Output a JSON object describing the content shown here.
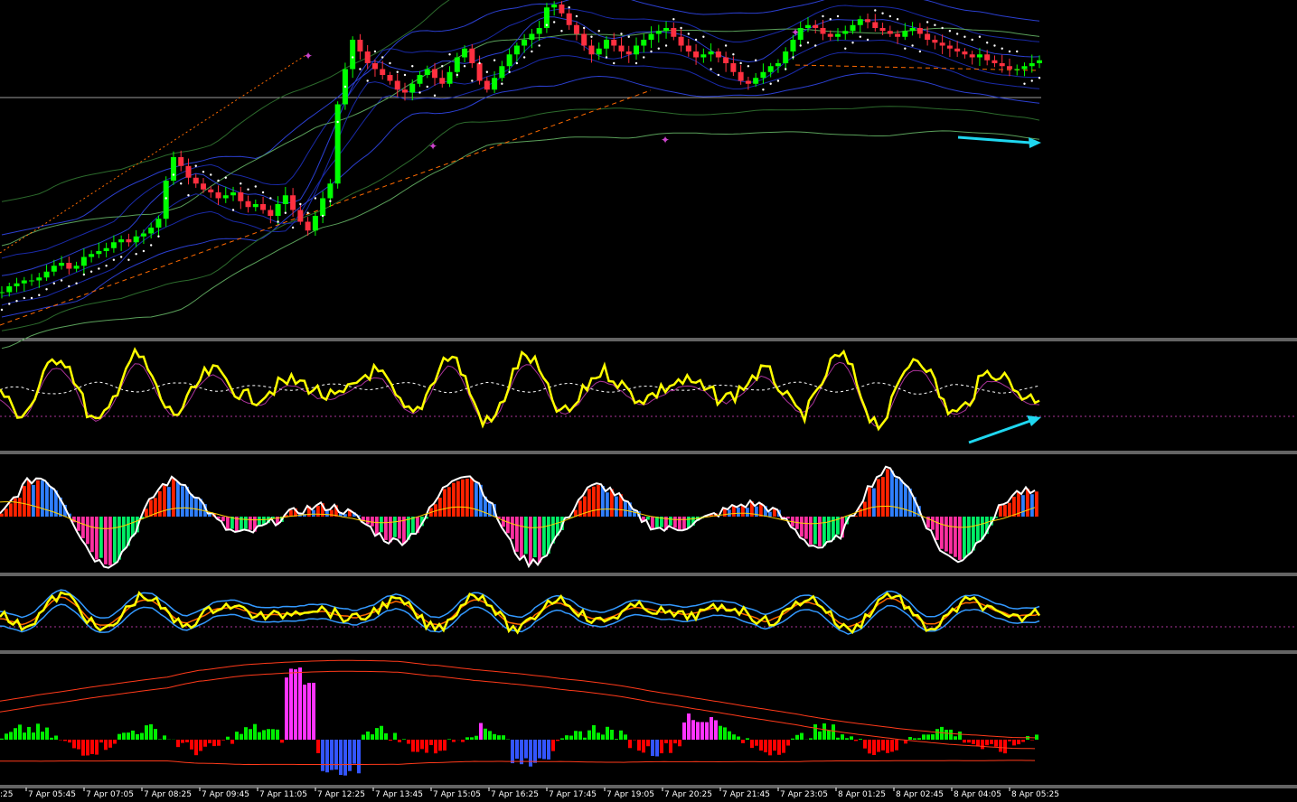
{
  "chart_data": {
    "type": "line",
    "title": "",
    "panes": [
      {
        "name": "main",
        "kind": "candles-with-bands",
        "colors": {
          "up": "#00ff00",
          "down": "#ff3040",
          "psar": "#ffffff",
          "bands": [
            "#1a2aa8",
            "#2b3fd0",
            "#2c6a2c",
            "#5aa05a"
          ],
          "trend": "#ff6a00",
          "arrow": "#1fd7f0",
          "marker": "#cc44cc"
        }
      },
      {
        "name": "oscillator-1",
        "kind": "line",
        "colors": {
          "main": "#ffff00",
          "signal": "#ffffff",
          "aux": "#aa3399"
        }
      },
      {
        "name": "oscillator-2",
        "kind": "histogram",
        "colors": {
          "pos": "#ff2200",
          "pos_high": "#2f7fff",
          "neg": "#00ee66",
          "neg_low": "#ff2fa0",
          "line": "#ffffff",
          "signal": "#ffd200"
        }
      },
      {
        "name": "oscillator-3",
        "kind": "line",
        "colors": {
          "main": "#ffff00",
          "mid": "#ff6600",
          "band": "#3399ff"
        }
      },
      {
        "name": "volume-oscillator",
        "kind": "histogram",
        "colors": {
          "pos": "#00ee00",
          "pos_high": "#ff33ff",
          "neg": "#ff0000",
          "neg_low": "#3355ff",
          "envelope": "#ff3a1a"
        }
      }
    ],
    "x_ticks": [
      "7 Apr 05:45",
      "7 Apr 07:05",
      "7 Apr 08:25",
      "7 Apr 09:45",
      "7 Apr 11:05",
      "7 Apr 12:25",
      "7 Apr 13:45",
      "7 Apr 15:05",
      "7 Apr 16:25",
      "7 Apr 17:45",
      "7 Apr 19:05",
      "7 Apr 20:25",
      "7 Apr 21:45",
      "7 Apr 23:05",
      "8 Apr 01:25",
      "8 Apr 02:45",
      "8 Apr 04:05",
      "8 Apr 05:25"
    ],
    "x_tick_partial": ":25",
    "close_series": [
      0.02,
      0.04,
      0.05,
      0.06,
      0.06,
      0.07,
      0.09,
      0.11,
      0.12,
      0.1,
      0.11,
      0.14,
      0.15,
      0.16,
      0.17,
      0.19,
      0.2,
      0.19,
      0.21,
      0.22,
      0.24,
      0.27,
      0.4,
      0.48,
      0.45,
      0.41,
      0.39,
      0.37,
      0.36,
      0.34,
      0.35,
      0.36,
      0.33,
      0.31,
      0.32,
      0.3,
      0.28,
      0.32,
      0.35,
      0.3,
      0.26,
      0.23,
      0.28,
      0.34,
      0.39,
      0.66,
      0.78,
      0.88,
      0.84,
      0.8,
      0.78,
      0.76,
      0.74,
      0.71,
      0.7,
      0.73,
      0.76,
      0.78,
      0.75,
      0.73,
      0.77,
      0.82,
      0.85,
      0.8,
      0.74,
      0.71,
      0.75,
      0.79,
      0.83,
      0.86,
      0.88,
      0.9,
      0.92,
      0.99,
      1.0,
      0.97,
      0.93,
      0.9,
      0.86,
      0.83,
      0.85,
      0.88,
      0.86,
      0.84,
      0.83,
      0.86,
      0.88,
      0.9,
      0.91,
      0.92,
      0.89,
      0.86,
      0.84,
      0.82,
      0.83,
      0.84,
      0.82,
      0.8,
      0.77,
      0.74,
      0.73,
      0.75,
      0.77,
      0.79,
      0.8,
      0.84,
      0.88,
      0.92,
      0.93,
      0.92,
      0.9,
      0.89,
      0.9,
      0.91,
      0.93,
      0.95,
      0.94,
      0.92,
      0.91,
      0.9,
      0.89,
      0.91,
      0.92,
      0.9,
      0.88,
      0.87,
      0.86,
      0.85,
      0.84,
      0.83,
      0.82,
      0.83,
      0.81,
      0.8,
      0.79,
      0.78,
      0.78,
      0.79,
      0.8,
      0.81
    ]
  }
}
